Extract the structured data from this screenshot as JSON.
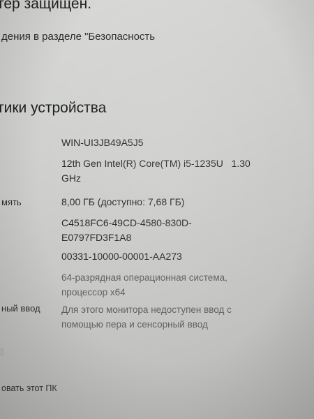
{
  "header": {
    "title_fragment": "тер защищен.",
    "notice_fragment": "дения в разделе \"Безопасность"
  },
  "section": {
    "heading": "тики устройства"
  },
  "specs": {
    "device_name": "WIN-UI3JB49A5J5",
    "processor_line1": "12th Gen Intel(R) Core(TM) i5-1235U   1.30",
    "processor_line2": "GHz",
    "ram_label": "мять",
    "ram_value": "8,00 ГБ (доступно: 7,68 ГБ)",
    "device_id_line1": "C4518FC6-49CD-4580-830D-",
    "device_id_line2": "E0797FD3F1A8",
    "product_id": "00331-10000-00001-AA273",
    "system_type_line1": "64-разрядная операционная система,",
    "system_type_line2": "процессор x64",
    "pen_label": "ный ввод",
    "pen_line1": "Для этого монитора недоступен ввод с",
    "pen_line2": "помощью пера и сенсорный ввод"
  },
  "footer": {
    "rename_link": "овать этот ПК"
  }
}
